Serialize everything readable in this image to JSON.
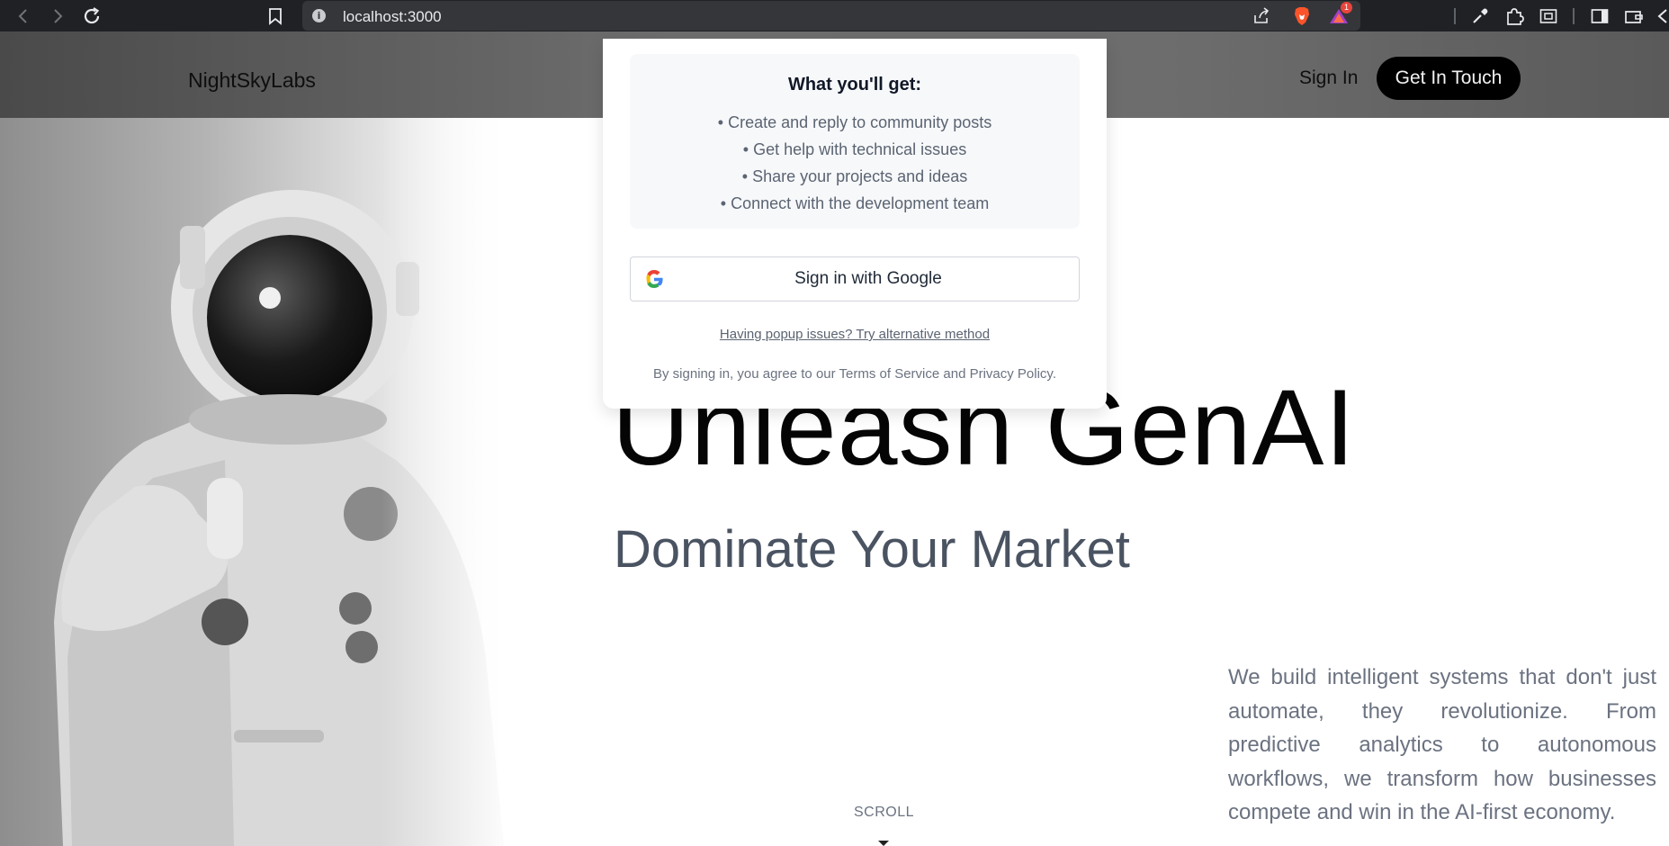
{
  "browser": {
    "url": "localhost:3000",
    "extension_badge_count": "1",
    "icons": [
      "back-icon",
      "forward-icon",
      "reload-icon",
      "bookmark-icon",
      "info-icon",
      "share-icon",
      "brave-lion-icon",
      "brave-rewards-icon",
      "eyedropper-icon",
      "extensions-puzzle-icon",
      "screenshot-icon",
      "sidebar-icon",
      "wallet-icon",
      "leo-icon"
    ]
  },
  "header": {
    "logo": "NightSkyLabs",
    "sign_in": "Sign In",
    "cta": "Get In Touch"
  },
  "hero": {
    "headline": "Unleash GenAI",
    "subhead": "Dominate Your Market",
    "body": "We build intelligent systems that don't just automate, they revolutionize. From predictive analytics to autonomous workflows, we transform how businesses compete and win in the AI-first economy.",
    "scroll": "SCROLL"
  },
  "modal": {
    "benefits_title": "What you'll get:",
    "benefits": [
      "• Create and reply to community posts",
      "• Get help with technical issues",
      "• Share your projects and ideas",
      "• Connect with the development team"
    ],
    "google_button": "Sign in with Google",
    "alt_link": "Having popup issues? Try alternative method",
    "terms": "By signing in, you agree to our Terms of Service and Privacy Policy."
  },
  "colors": {
    "chrome_bg": "#202124",
    "address_bar": "#35363a",
    "cta_bg": "#000000",
    "headline": "#050505",
    "subhead": "#4a5361",
    "body_text": "#6b7280"
  }
}
